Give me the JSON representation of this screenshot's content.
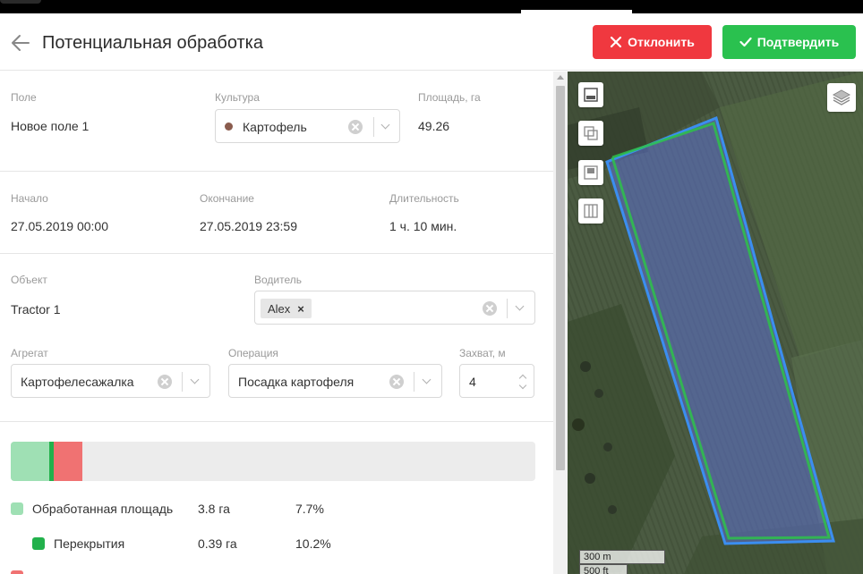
{
  "header": {
    "title": "Потенциальная обработка",
    "reject_label": "Отклонить",
    "confirm_label": "Подтвердить"
  },
  "field": {
    "label": "Поле",
    "value": "Новое поле 1"
  },
  "crop": {
    "label": "Культура",
    "value": "Картофель",
    "color": "#8a5c4e"
  },
  "area": {
    "label": "Площадь, га",
    "value": "49.26"
  },
  "start": {
    "label": "Начало",
    "value": "27.05.2019 00:00"
  },
  "end": {
    "label": "Окончание",
    "value": "27.05.2019 23:59"
  },
  "duration": {
    "label": "Длительность",
    "value": "1 ч. 10 мин."
  },
  "object": {
    "label": "Объект",
    "value": "Tractor 1"
  },
  "driver": {
    "label": "Водитель",
    "tags": [
      "Alex"
    ],
    "tag_remove": "×"
  },
  "implement": {
    "label": "Агрегат",
    "value": "Картофелесажалка"
  },
  "operation": {
    "label": "Операция",
    "value": "Посадка картофеля"
  },
  "width": {
    "label": "Захват, м",
    "value": "4"
  },
  "progress": {
    "processed_fraction": 0.077,
    "overlap_fraction": 0.0079,
    "unprocessed_fraction": 0.054,
    "colors": {
      "processed": "#9fe0b4",
      "overlap": "#22b14c",
      "other": "#f07272",
      "track": "#ececec"
    }
  },
  "stats": [
    {
      "label": "Обработанная площадь",
      "value": "3.8 га",
      "percent": "7.7%",
      "color": "#9fe0b4"
    },
    {
      "label": "Перекрытия",
      "value": "0.39 га",
      "percent": "10.2%",
      "color": "#22b14c"
    }
  ],
  "map": {
    "scale_metric": "300 m",
    "scale_imperial": "500 ft",
    "field_outline_color": "#3b8ef0",
    "field_fill_color": "#5c6fcf",
    "track_color": "#2ec24a",
    "tools": [
      "zoom-fit-icon",
      "compare-icon",
      "square-icon",
      "columns-icon"
    ],
    "layers_icon": "layers-icon"
  }
}
